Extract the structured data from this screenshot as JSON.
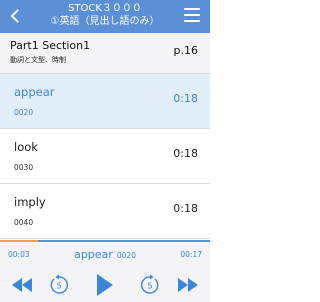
{
  "header": {
    "title_line1": "STOCK３０００",
    "title_line2": "①英語（見出し語のみ）"
  },
  "section": {
    "title": "Part1 Section1",
    "subtitle": "動詞と文型、時制",
    "page": "p.16"
  },
  "items": [
    {
      "word": "appear",
      "num": "0020",
      "time": "0:18",
      "active": true
    },
    {
      "word": "look",
      "num": "0030",
      "time": "0:18",
      "active": false
    },
    {
      "word": "imply",
      "num": "0040",
      "time": "0:18",
      "active": false
    }
  ],
  "player": {
    "current_time": "00:03",
    "duration": "00:17",
    "now_word": "appear",
    "now_num": "0020",
    "progress_fraction": 0.18,
    "replay_seconds": "5",
    "forward_seconds": "5"
  },
  "colors": {
    "header": "#5b8fd6",
    "accent": "#3b86d8",
    "active_row": "#e3eefb",
    "progress": "#f2a33a"
  },
  "icons": {
    "back": "chevron-left-icon",
    "menu": "hamburger-menu-icon",
    "previous": "rewind-icon",
    "replay": "replay-5-icon",
    "play": "play-icon",
    "forward": "forward-5-icon",
    "next": "fast-forward-icon"
  }
}
